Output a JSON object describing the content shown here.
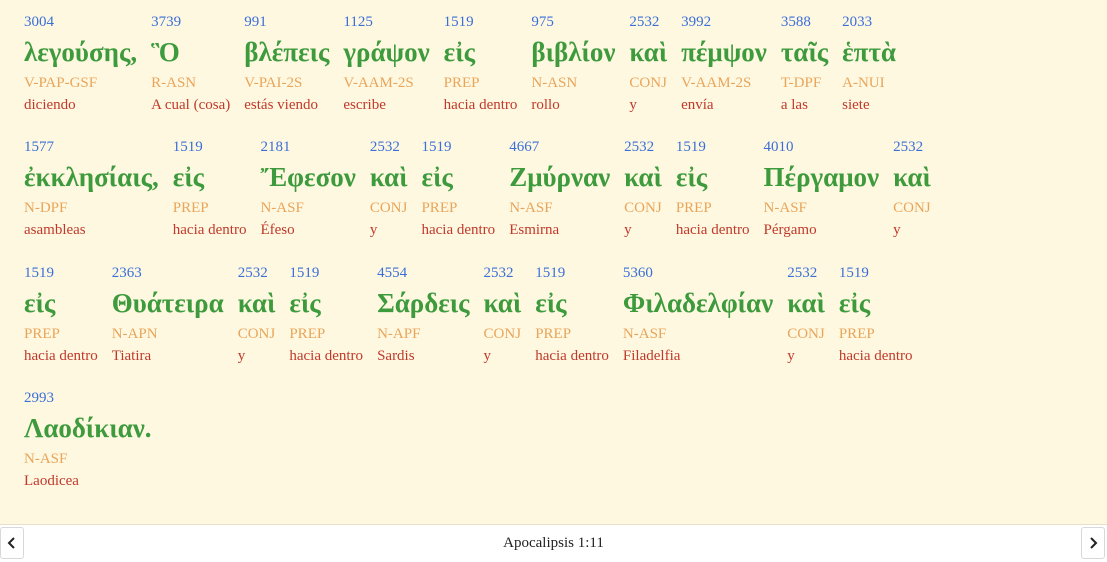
{
  "verse": {
    "lines": [
      [
        {
          "strong": "3004",
          "greek": "λεγούσης,",
          "morph": "V-PAP-GSF",
          "gloss": "diciendo"
        },
        {
          "strong": "3739",
          "greek": "Ὃ",
          "morph": "R-ASN",
          "gloss": "A cual (cosa)"
        },
        {
          "strong": "991",
          "greek": "βλέπεις",
          "morph": "V-PAI-2S",
          "gloss": "estás viendo"
        },
        {
          "strong": "1125",
          "greek": "γράψον",
          "morph": "V-AAM-2S",
          "gloss": "escribe"
        },
        {
          "strong": "1519",
          "greek": "εἰς",
          "morph": "PREP",
          "gloss": "hacia dentro"
        },
        {
          "strong": "975",
          "greek": "βιβλίον",
          "morph": "N-ASN",
          "gloss": "rollo"
        },
        {
          "strong": "2532",
          "greek": "καὶ",
          "morph": "CONJ",
          "gloss": "y"
        },
        {
          "strong": "3992",
          "greek": "πέμψον",
          "morph": "V-AAM-2S",
          "gloss": "envía"
        },
        {
          "strong": "3588",
          "greek": "ταῖς",
          "morph": "T-DPF",
          "gloss": "a las"
        },
        {
          "strong": "2033",
          "greek": "ἑπτὰ",
          "morph": "A-NUI",
          "gloss": "siete"
        }
      ],
      [
        {
          "strong": "1577",
          "greek": "ἐκκλησίαις,",
          "morph": "N-DPF",
          "gloss": "asambleas"
        },
        {
          "strong": "1519",
          "greek": "εἰς",
          "morph": "PREP",
          "gloss": "hacia dentro"
        },
        {
          "strong": "2181",
          "greek": "Ἔφεσον",
          "morph": "N-ASF",
          "gloss": "Éfeso"
        },
        {
          "strong": "2532",
          "greek": "καὶ",
          "morph": "CONJ",
          "gloss": "y"
        },
        {
          "strong": "1519",
          "greek": "εἰς",
          "morph": "PREP",
          "gloss": "hacia dentro"
        },
        {
          "strong": "4667",
          "greek": "Ζμύρναν",
          "morph": "N-ASF",
          "gloss": "Esmirna"
        },
        {
          "strong": "2532",
          "greek": "καὶ",
          "morph": "CONJ",
          "gloss": "y"
        },
        {
          "strong": "1519",
          "greek": "εἰς",
          "morph": "PREP",
          "gloss": "hacia dentro"
        },
        {
          "strong": "4010",
          "greek": "Πέργαμον",
          "morph": "N-ASF",
          "gloss": "Pérgamo"
        },
        {
          "strong": "2532",
          "greek": "καὶ",
          "morph": "CONJ",
          "gloss": "y"
        }
      ],
      [
        {
          "strong": "1519",
          "greek": "εἰς",
          "morph": "PREP",
          "gloss": "hacia dentro"
        },
        {
          "strong": "2363",
          "greek": "Θυάτειρα",
          "morph": "N-APN",
          "gloss": "Tiatira"
        },
        {
          "strong": "2532",
          "greek": "καὶ",
          "morph": "CONJ",
          "gloss": "y"
        },
        {
          "strong": "1519",
          "greek": "εἰς",
          "morph": "PREP",
          "gloss": "hacia dentro"
        },
        {
          "strong": "4554",
          "greek": "Σάρδεις",
          "morph": "N-APF",
          "gloss": "Sardis"
        },
        {
          "strong": "2532",
          "greek": "καὶ",
          "morph": "CONJ",
          "gloss": "y"
        },
        {
          "strong": "1519",
          "greek": "εἰς",
          "morph": "PREP",
          "gloss": "hacia dentro"
        },
        {
          "strong": "5360",
          "greek": "Φιλαδελφίαν",
          "morph": "N-ASF",
          "gloss": "Filadelfia"
        },
        {
          "strong": "2532",
          "greek": "καὶ",
          "morph": "CONJ",
          "gloss": "y"
        },
        {
          "strong": "1519",
          "greek": "εἰς",
          "morph": "PREP",
          "gloss": "hacia dentro"
        }
      ],
      [
        {
          "strong": "2993",
          "greek": "Λαοδίκιαν.",
          "morph": "N-ASF",
          "gloss": "Laodicea"
        }
      ]
    ]
  },
  "nav": {
    "reference": "Apocalipsis 1:11",
    "prev_icon": "chevron-left-icon",
    "next_icon": "chevron-right-icon"
  },
  "colors": {
    "background": "#fff8e1",
    "strong_number": "#3a6fd8",
    "greek_word": "#3d9b3d",
    "morphology": "#e8a55a",
    "gloss": "#c0392b"
  }
}
